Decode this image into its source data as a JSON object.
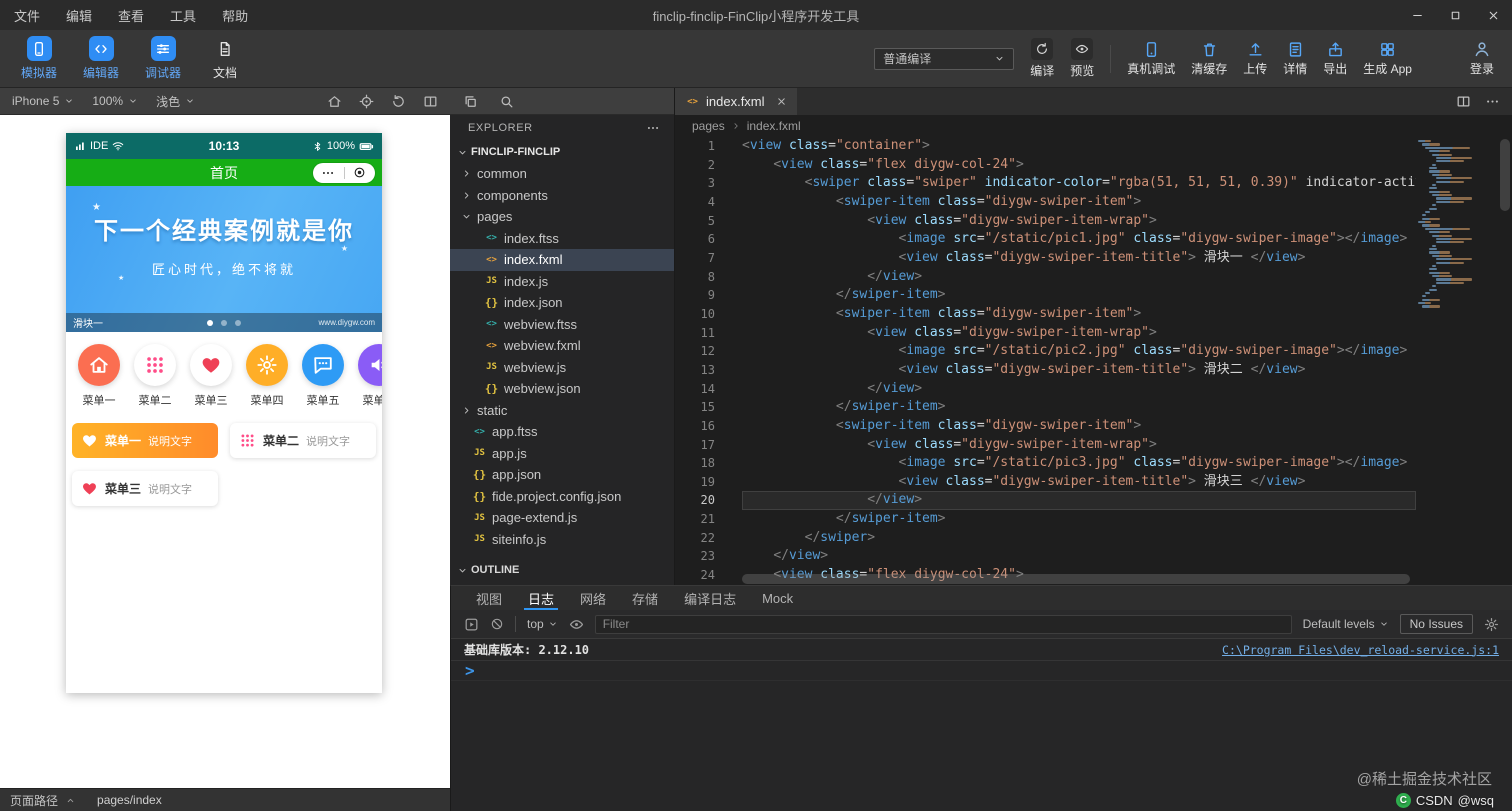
{
  "titlebar": {
    "menus": [
      "文件",
      "编辑",
      "查看",
      "工具",
      "帮助"
    ],
    "title": "finclip-finclip-FinClip小程序开发工具",
    "window_controls": [
      {
        "name": "minimize",
        "icon": "min"
      },
      {
        "name": "maximize",
        "icon": "max"
      },
      {
        "name": "close",
        "icon": "x"
      }
    ]
  },
  "toolbar": {
    "left_buttons": [
      {
        "label": "模拟器",
        "icon": "phone",
        "accent": true
      },
      {
        "label": "编辑器",
        "icon": "code",
        "accent": true
      },
      {
        "label": "调试器",
        "icon": "sliders",
        "accent": true
      },
      {
        "label": "文档",
        "icon": "doc",
        "accent": false
      }
    ],
    "compile_mode": "普通编译",
    "right_buttons": [
      {
        "label": "编译",
        "icon": "refresh",
        "boxed": true
      },
      {
        "label": "预览",
        "icon": "eye",
        "boxed": true
      },
      {
        "sep": true
      },
      {
        "label": "真机调试",
        "icon": "device",
        "boxed": false
      },
      {
        "label": "清缓存",
        "icon": "clean",
        "boxed": false
      },
      {
        "label": "上传",
        "icon": "upload",
        "boxed": false
      },
      {
        "label": "详情",
        "icon": "detail",
        "boxed": false
      },
      {
        "label": "导出",
        "icon": "export",
        "boxed": false
      },
      {
        "label": "生成 App",
        "icon": "app",
        "boxed": false
      }
    ],
    "login": {
      "label": "登录",
      "icon": "user"
    }
  },
  "simulator": {
    "toolbar": {
      "selects": [
        {
          "id": "device",
          "value": "iPhone 5"
        },
        {
          "id": "zoom",
          "value": "100%"
        },
        {
          "id": "theme",
          "value": "浅色"
        }
      ],
      "icons": [
        "home",
        "locate",
        "rotate",
        "columns"
      ]
    },
    "phone": {
      "statusbar": {
        "carrier": "IDE",
        "time": "10:13",
        "battery": "100%"
      },
      "navbar": {
        "title": "首页"
      },
      "banner": {
        "line1": "下一个经典案例就是你",
        "line2": "匠心时代，绝不将就",
        "sparkles": [
          "★",
          "★",
          "★"
        ],
        "slide_label": "滑块一",
        "watermark": "www.diygw.com",
        "dots": 3,
        "active_dot": 0
      },
      "menu_grid": [
        {
          "label": "菜单一",
          "icon": "house",
          "bg": "#fb6e51",
          "fg": "#ffffff"
        },
        {
          "label": "菜单二",
          "icon": "dots",
          "bg": "#ffffff",
          "fg": "#ff4d88"
        },
        {
          "label": "菜单三",
          "icon": "heart",
          "bg": "#ffffff",
          "fg": "#ef4056"
        },
        {
          "label": "菜单四",
          "icon": "gear",
          "bg": "#ffae27",
          "fg": "#ffffff"
        },
        {
          "label": "菜单五",
          "icon": "chat",
          "bg": "#2e9bf5",
          "fg": "#ffffff"
        },
        {
          "label": "菜单六",
          "icon": "speaker",
          "bg": "#8a5cf6",
          "fg": "#ffffff"
        }
      ],
      "menu_cards": [
        [
          {
            "title": "菜单一",
            "desc": "说明文字",
            "icon": "heart",
            "variant": "orange",
            "icon_color": "#ffffff"
          },
          {
            "title": "菜单二",
            "desc": "说明文字",
            "icon": "dots",
            "variant": "white",
            "icon_color": "#ff4d88"
          }
        ],
        [
          {
            "title": "菜单三",
            "desc": "说明文字",
            "icon": "heart",
            "variant": "white",
            "icon_color": "#ef4056"
          }
        ]
      ]
    },
    "status_bottom": {
      "label": "页面路径",
      "value": "pages/index"
    }
  },
  "explorer": {
    "strip_icons": [
      "copy",
      "search"
    ],
    "title": "EXPLORER",
    "root": "FINCLIP-FINCLIP",
    "items": [
      {
        "name": "common",
        "type": "folder",
        "depth": 1,
        "expanded": false
      },
      {
        "name": "components",
        "type": "folder",
        "depth": 1,
        "expanded": false
      },
      {
        "name": "pages",
        "type": "folder",
        "depth": 1,
        "expanded": true
      },
      {
        "name": "index.ftss",
        "type": "ftss",
        "depth": 2
      },
      {
        "name": "index.fxml",
        "type": "fxml",
        "depth": 2,
        "selected": true
      },
      {
        "name": "index.js",
        "type": "js",
        "depth": 2
      },
      {
        "name": "index.json",
        "type": "json",
        "depth": 2
      },
      {
        "name": "webview.ftss",
        "type": "ftss",
        "depth": 2
      },
      {
        "name": "webview.fxml",
        "type": "fxml",
        "depth": 2
      },
      {
        "name": "webview.js",
        "type": "js",
        "depth": 2
      },
      {
        "name": "webview.json",
        "type": "json",
        "depth": 2
      },
      {
        "name": "static",
        "type": "folder",
        "depth": 1,
        "expanded": false
      },
      {
        "name": "app.ftss",
        "type": "ftss",
        "depth": 1
      },
      {
        "name": "app.js",
        "type": "js",
        "depth": 1
      },
      {
        "name": "app.json",
        "type": "json",
        "depth": 1
      },
      {
        "name": "fide.project.config.json",
        "type": "json",
        "depth": 1
      },
      {
        "name": "page-extend.js",
        "type": "js",
        "depth": 1
      },
      {
        "name": "siteinfo.js",
        "type": "js",
        "depth": 1
      }
    ],
    "outline": "OUTLINE"
  },
  "editor": {
    "tab": {
      "name": "index.fxml"
    },
    "breadcrumb": [
      "pages",
      "index.fxml"
    ],
    "code_lines": [
      {
        "n": 1,
        "text": "<view class=\"container\">"
      },
      {
        "n": 2,
        "text": "    <view class=\"flex diygw-col-24\">"
      },
      {
        "n": 3,
        "text": "        <swiper class=\"swiper\" indicator-color=\"rgba(51, 51, 51, 0.39)\" indicator-active-c"
      },
      {
        "n": 4,
        "text": "            <swiper-item class=\"diygw-swiper-item\">"
      },
      {
        "n": 5,
        "text": "                <view class=\"diygw-swiper-item-wrap\">"
      },
      {
        "n": 6,
        "text": "                    <image src=\"/static/pic1.jpg\" class=\"diygw-swiper-image\"></image>"
      },
      {
        "n": 7,
        "text": "                    <view class=\"diygw-swiper-item-title\"> 滑块一 </view>"
      },
      {
        "n": 8,
        "text": "                </view>"
      },
      {
        "n": 9,
        "text": "            </swiper-item>"
      },
      {
        "n": 10,
        "text": "            <swiper-item class=\"diygw-swiper-item\">"
      },
      {
        "n": 11,
        "text": "                <view class=\"diygw-swiper-item-wrap\">"
      },
      {
        "n": 12,
        "text": "                    <image src=\"/static/pic2.jpg\" class=\"diygw-swiper-image\"></image>"
      },
      {
        "n": 13,
        "text": "                    <view class=\"diygw-swiper-item-title\"> 滑块二 </view>"
      },
      {
        "n": 14,
        "text": "                </view>"
      },
      {
        "n": 15,
        "text": "            </swiper-item>"
      },
      {
        "n": 16,
        "text": "            <swiper-item class=\"diygw-swiper-item\">"
      },
      {
        "n": 17,
        "text": "                <view class=\"diygw-swiper-item-wrap\">"
      },
      {
        "n": 18,
        "text": "                    <image src=\"/static/pic3.jpg\" class=\"diygw-swiper-image\"></image>"
      },
      {
        "n": 19,
        "text": "                    <view class=\"diygw-swiper-item-title\"> 滑块三 </view>"
      },
      {
        "n": 20,
        "text": "                </view>",
        "current": true
      },
      {
        "n": 21,
        "text": "            </swiper-item>"
      },
      {
        "n": 22,
        "text": "        </swiper>"
      },
      {
        "n": 23,
        "text": "    </view>"
      },
      {
        "n": 24,
        "text": "    <view class=\"flex diygw-col-24\">"
      }
    ]
  },
  "bottom_panel": {
    "tabs": [
      {
        "label": "视图",
        "active": false
      },
      {
        "label": "日志",
        "active": true
      },
      {
        "label": "网络",
        "active": false
      },
      {
        "label": "存储",
        "active": false
      },
      {
        "label": "编译日志",
        "active": false
      },
      {
        "label": "Mock",
        "active": false
      }
    ],
    "console_toolbar": {
      "icons_left": [
        "play",
        "ban"
      ],
      "scope": "top",
      "filter_placeholder": "Filter",
      "levels_label": "Default levels",
      "issues_label": "No Issues"
    },
    "messages": [
      {
        "text": "基础库版本: 2.12.10",
        "link": "C:\\Program Files\\dev_reload-service.js:1"
      }
    ],
    "prompt": ">"
  },
  "watermarks": {
    "juejin": "@稀土掘金技术社区",
    "csdn_logo_letter": "C",
    "csdn_brand": "CSDN",
    "csdn_user": "@wsq"
  },
  "accent_colors": {
    "blue": "#2f8df4",
    "green": "#16ad15",
    "tab_underline": "#2f96f3"
  }
}
